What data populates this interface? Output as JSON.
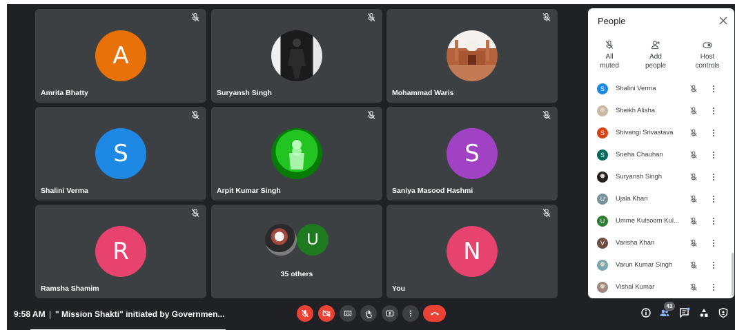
{
  "tiles": [
    {
      "name": "Amrita Bhatty",
      "initial": "A",
      "color": "#e8710a",
      "kind": "initial"
    },
    {
      "name": "Suryansh Singh",
      "initial": "",
      "color": "#1f1f1f",
      "kind": "photo-person"
    },
    {
      "name": "Mohammad Waris",
      "initial": "",
      "color": "#b65e3c",
      "kind": "photo-mosque"
    },
    {
      "name": "Shalini Verma",
      "initial": "S",
      "color": "#1e88e5",
      "kind": "initial"
    },
    {
      "name": "Arpit Kumar Singh",
      "initial": "",
      "color": "#1db31d",
      "kind": "photo-green"
    },
    {
      "name": "Saniya Masood Hashmi",
      "initial": "S",
      "color": "#a142c4",
      "kind": "initial"
    },
    {
      "name": "Ramsha Shamim",
      "initial": "R",
      "color": "#e8436f",
      "kind": "initial"
    },
    {
      "name": "",
      "initial": "U",
      "color": "#1e7a1e",
      "kind": "others"
    },
    {
      "name": "You",
      "initial": "N",
      "color": "#e8436f",
      "kind": "initial"
    }
  ],
  "others": {
    "caption": "35 others",
    "initial": "U",
    "color": "#1e7a1e"
  },
  "panel": {
    "title": "People",
    "actions": [
      {
        "label1": "All",
        "label2": "muted",
        "icon": "mic-off-icon"
      },
      {
        "label1": "Add",
        "label2": "people",
        "icon": "person-add-icon"
      },
      {
        "label1": "Host",
        "label2": "controls",
        "icon": "toggle-icon"
      }
    ],
    "participants": [
      {
        "name": "Shalini Verma",
        "initial": "S",
        "color": "#1e88e5",
        "photo": false
      },
      {
        "name": "Sheikh Alisha",
        "initial": "",
        "color": "#c9b9a4",
        "photo": true
      },
      {
        "name": "Shivangi Srivastava",
        "initial": "S",
        "color": "#d84315",
        "photo": false
      },
      {
        "name": "Sneha Chauhan",
        "initial": "S",
        "color": "#00695c",
        "photo": false
      },
      {
        "name": "Suryansh Singh",
        "initial": "",
        "color": "#212121",
        "photo": true
      },
      {
        "name": "Ujala Khan",
        "initial": "U",
        "color": "#78909c",
        "photo": false
      },
      {
        "name": "Umme Kulsoom Kul...",
        "initial": "U",
        "color": "#2e7d32",
        "photo": false
      },
      {
        "name": "Varisha Khan",
        "initial": "V",
        "color": "#6d4c41",
        "photo": false
      },
      {
        "name": "Varun Kumar Singh",
        "initial": "",
        "color": "#7aa7b3",
        "photo": true
      },
      {
        "name": "Vishal Kumar",
        "initial": "",
        "color": "#a1887f",
        "photo": true
      }
    ]
  },
  "bottom": {
    "time": "9:58 AM",
    "separator": "|",
    "meeting_title": "\" Mission Shakti\" initiated by Governmen...",
    "participant_count": "43"
  }
}
